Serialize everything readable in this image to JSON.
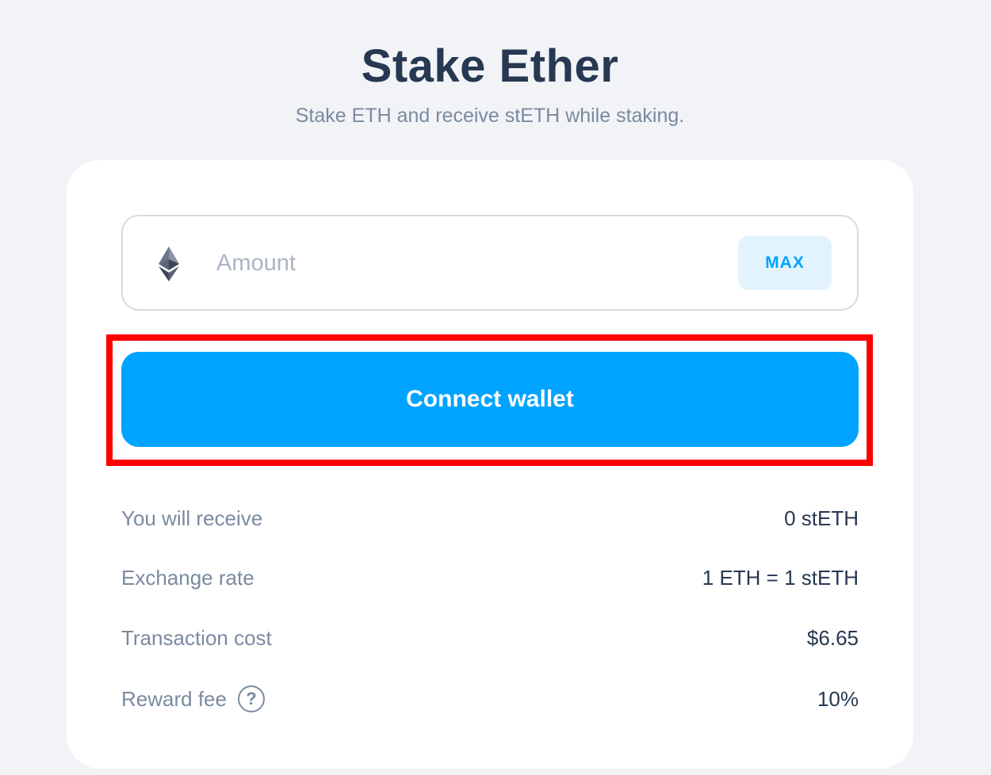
{
  "header": {
    "title": "Stake Ether",
    "subtitle": "Stake ETH and receive stETH while staking."
  },
  "form": {
    "token_icon": "ethereum-icon",
    "amount_placeholder": "Amount",
    "amount_value": "",
    "max_label": "MAX",
    "connect_label": "Connect wallet"
  },
  "info": {
    "receive_label": "You will receive",
    "receive_value": "0 stETH",
    "rate_label": "Exchange rate",
    "rate_value": "1 ETH = 1 stETH",
    "cost_label": "Transaction cost",
    "cost_value": "$6.65",
    "fee_label": "Reward fee",
    "fee_help_glyph": "?",
    "fee_value": "10%"
  },
  "colors": {
    "accent": "#00a3ff",
    "highlight": "#ff0000",
    "title": "#273852",
    "muted": "#7a8aa0"
  }
}
